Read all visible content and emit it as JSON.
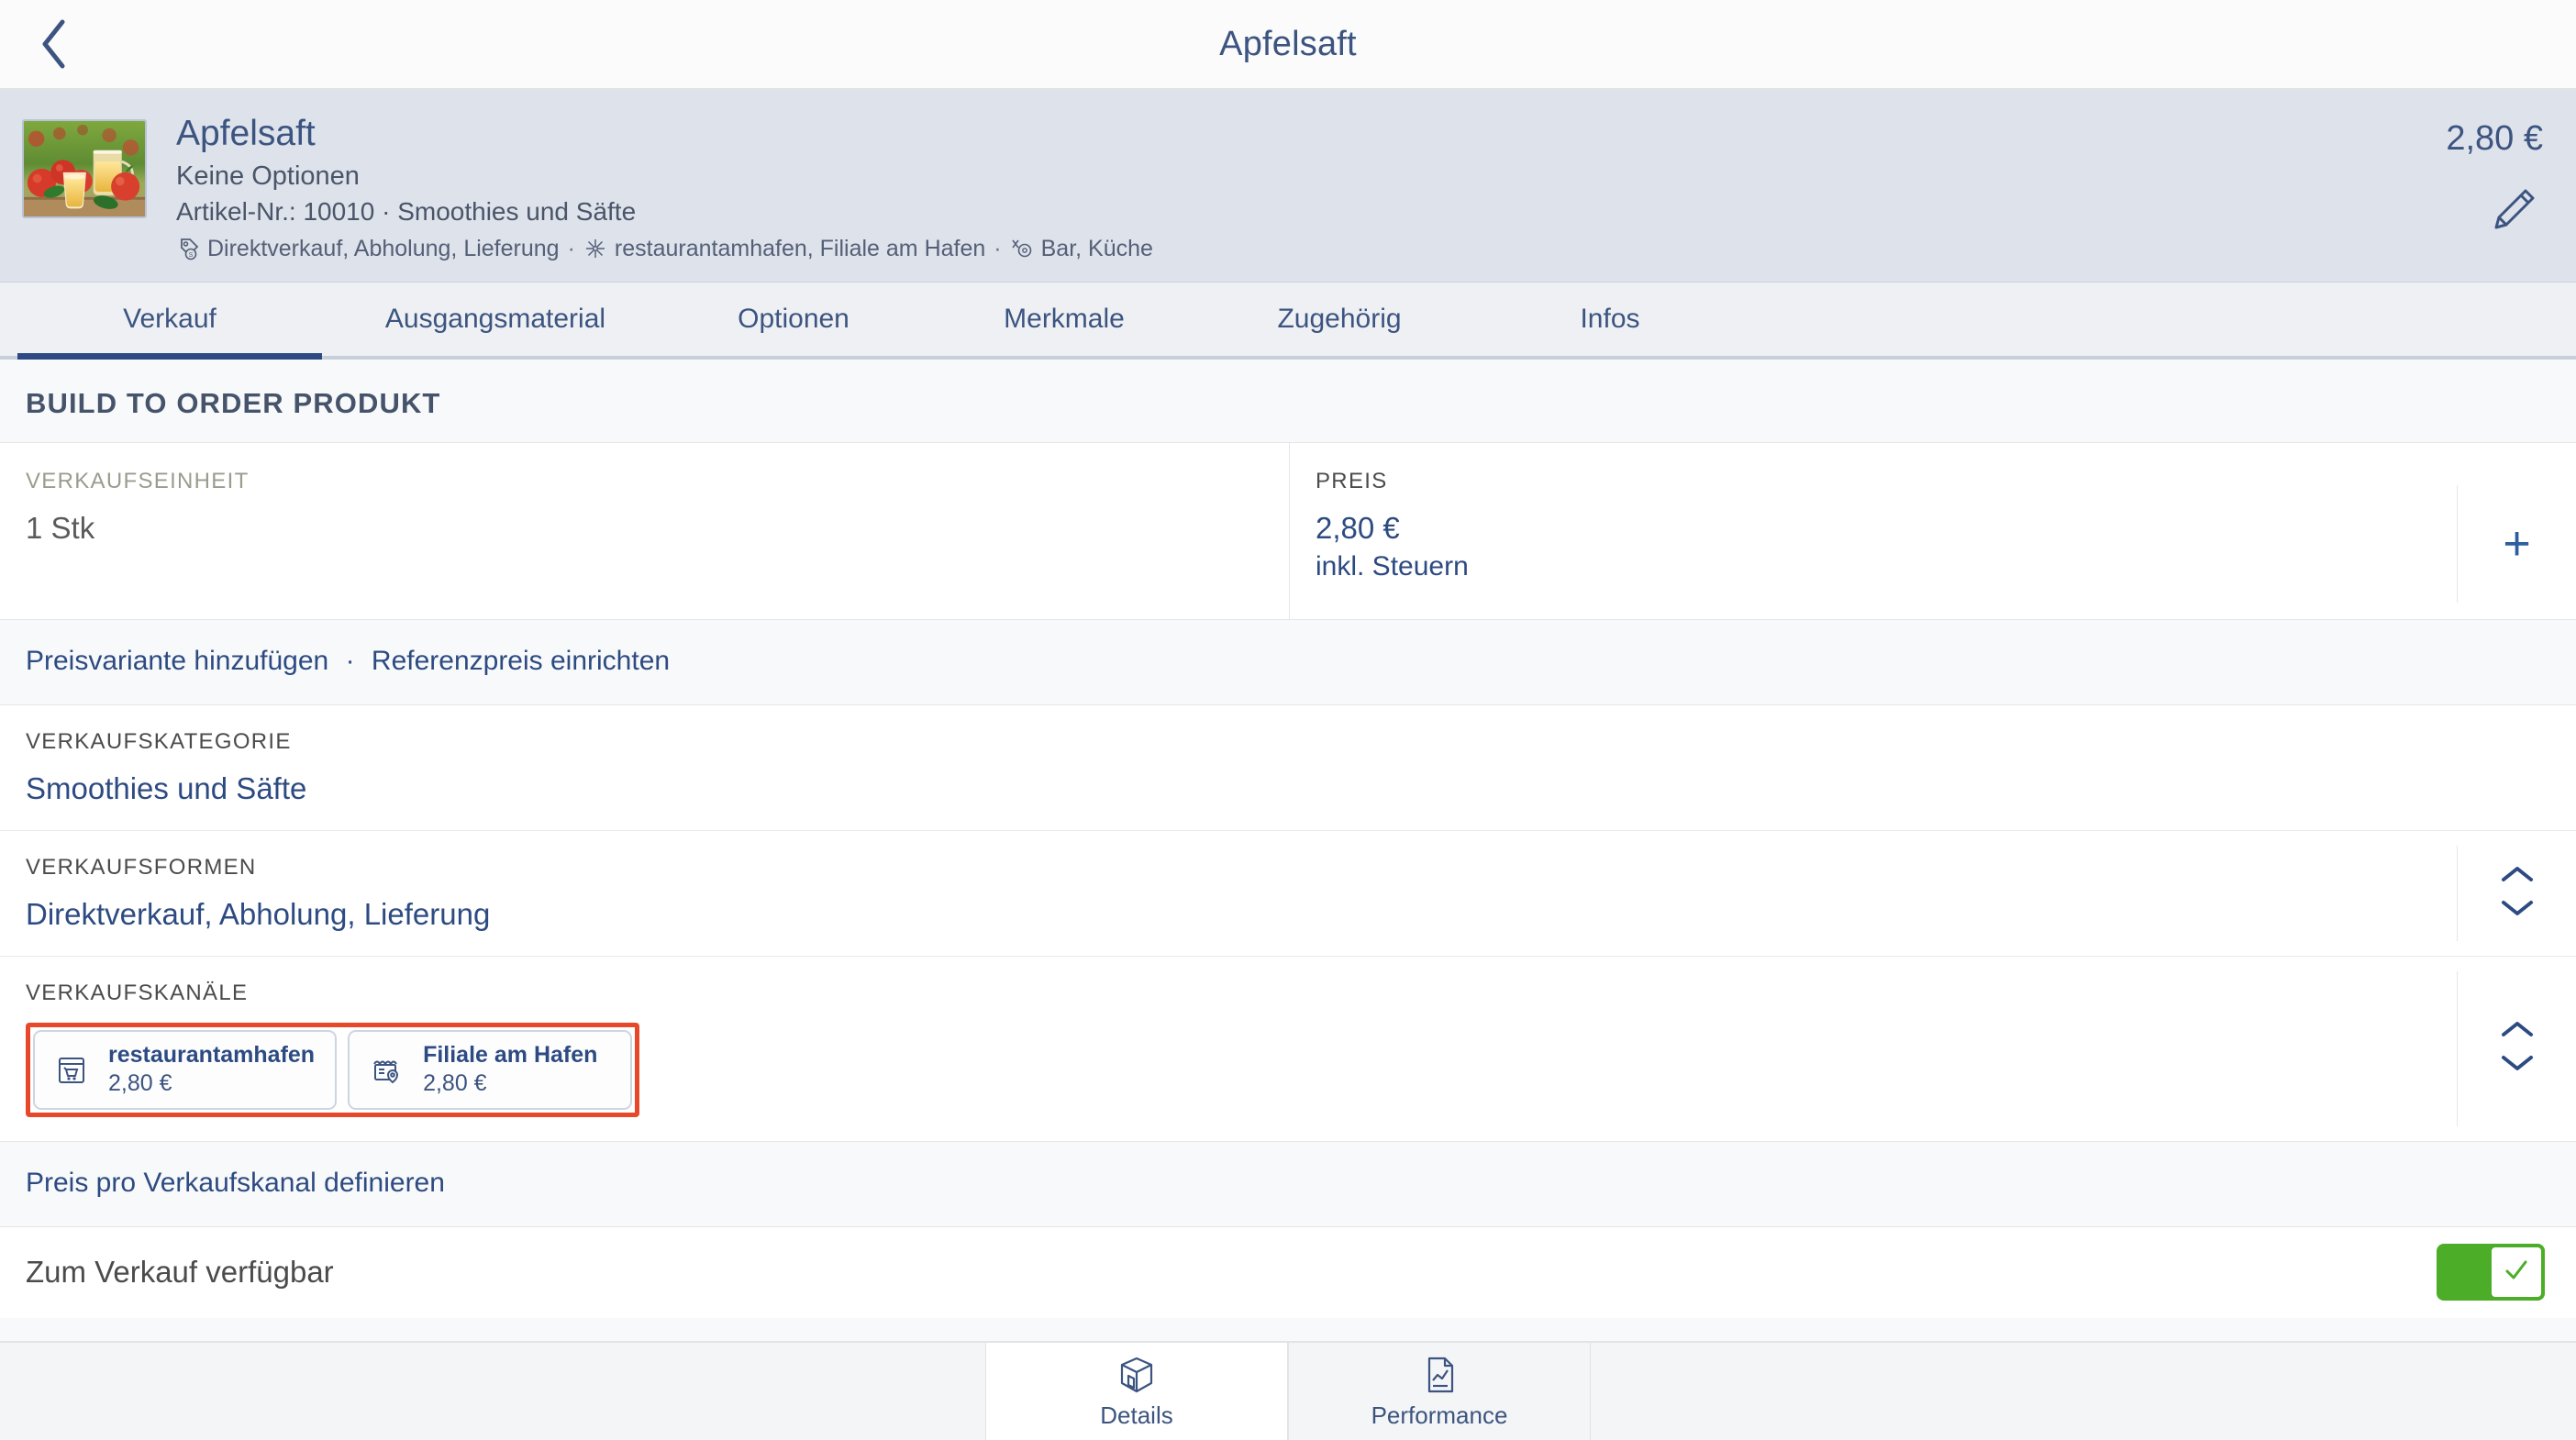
{
  "navbar": {
    "back_icon": "chevron-left-icon",
    "title": "Apfelsaft"
  },
  "product_header": {
    "thumbnail_icon": "apple-juice-photo",
    "name": "Apfelsaft",
    "options_label": "Keine Optionen",
    "article_line": "Artikel-Nr.: 10010 · Smoothies und Säfte",
    "meta": {
      "sales_forms_icon": "price-tag-icon",
      "sales_forms": "Direktverkauf, Abholung, Lieferung",
      "sep1": "·",
      "channels_icon": "network-nodes-icon",
      "channels": "restaurantamhafen, Filiale am Hafen",
      "sep2": "·",
      "areas_icon": "kitchen-target-icon",
      "areas": "Bar, Küche"
    },
    "price": "2,80 €",
    "edit_icon": "pencil-icon"
  },
  "tabs": [
    {
      "label": "Verkauf",
      "active": true
    },
    {
      "label": "Ausgangsmaterial",
      "active": false
    },
    {
      "label": "Optionen",
      "active": false
    },
    {
      "label": "Merkmale",
      "active": false
    },
    {
      "label": "Zugehörig",
      "active": false
    },
    {
      "label": "Infos",
      "active": false
    }
  ],
  "main": {
    "section_title": "BUILD TO ORDER PRODUKT",
    "sales_unit": {
      "label": "VERKAUFSEINHEIT",
      "value": "1 Stk"
    },
    "price_block": {
      "label": "PREIS",
      "value": "2,80 €",
      "tax_note": "inkl. Steuern",
      "add_icon": "plus-icon"
    },
    "price_links": {
      "add_variant": "Preisvariante hinzufügen",
      "separator": "·",
      "reference_price": "Referenzpreis einrichten"
    },
    "sales_category": {
      "label": "VERKAUFSKATEGORIE",
      "value": "Smoothies und Säfte"
    },
    "sales_forms": {
      "label": "VERKAUFSFORMEN",
      "value": "Direktverkauf, Abholung, Lieferung",
      "stepper_icon": "chevron-up-down-icon"
    },
    "sales_channels": {
      "label": "VERKAUFSKANÄLE",
      "highlight_color": "#e8482a",
      "stepper_icon": "chevron-up-down-icon",
      "chips": [
        {
          "icon": "kiosk-cart-icon",
          "name": "restaurantamhafen",
          "price": "2,80 €"
        },
        {
          "icon": "store-pin-icon",
          "name": "Filiale am Hafen",
          "price": "2,80 €"
        }
      ]
    },
    "channel_price_link": "Preis pro Verkaufskanal definieren",
    "available_toggle": {
      "label": "Zum Verkauf verfügbar",
      "state": "on",
      "on_color": "#4cae28",
      "check_icon": "check-icon"
    }
  },
  "bottom_bar": {
    "tabs": [
      {
        "icon": "box-3d-icon",
        "label": "Details",
        "active": true
      },
      {
        "icon": "document-chart-icon",
        "label": "Performance",
        "active": false
      }
    ]
  },
  "colors": {
    "accent_blue": "#2d4b82",
    "header_bg": "#dde2eb",
    "highlight_red": "#e8482a",
    "toggle_green": "#4cae28"
  }
}
